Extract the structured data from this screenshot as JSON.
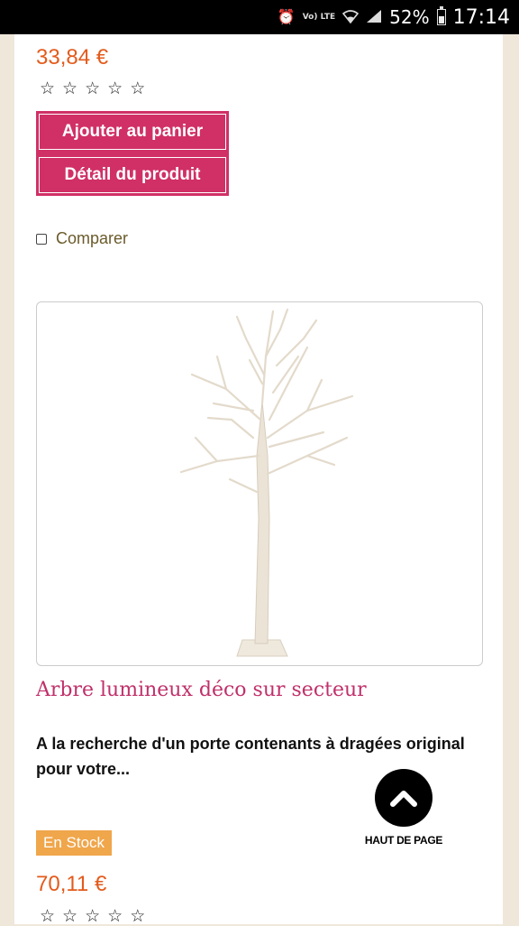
{
  "status_bar": {
    "volte": "Vo) LTE",
    "battery": "52%",
    "time": "17:14"
  },
  "product_top": {
    "price": "33,84 €",
    "rating": 0,
    "stars": [
      "☆",
      "☆",
      "☆",
      "☆",
      "☆"
    ],
    "add_to_cart": "Ajouter au panier",
    "detail": "Détail du produit",
    "compare": "Comparer"
  },
  "product_second": {
    "title": "Arbre lumineux déco sur secteur",
    "description": "A la recherche d'un porte contenants à dragées original pour votre...",
    "stock": "En Stock",
    "price": "70,11 €",
    "rating": 0,
    "stars": [
      "☆",
      "☆",
      "☆",
      "☆",
      "☆"
    ]
  },
  "back_to_top": {
    "label": "HAUT DE PAGE",
    "icon": "chevron-up-icon"
  },
  "colors": {
    "accent": "#d03066",
    "price": "#e35b1c",
    "stock_badge": "#f0a64b",
    "title": "#c0306a"
  }
}
